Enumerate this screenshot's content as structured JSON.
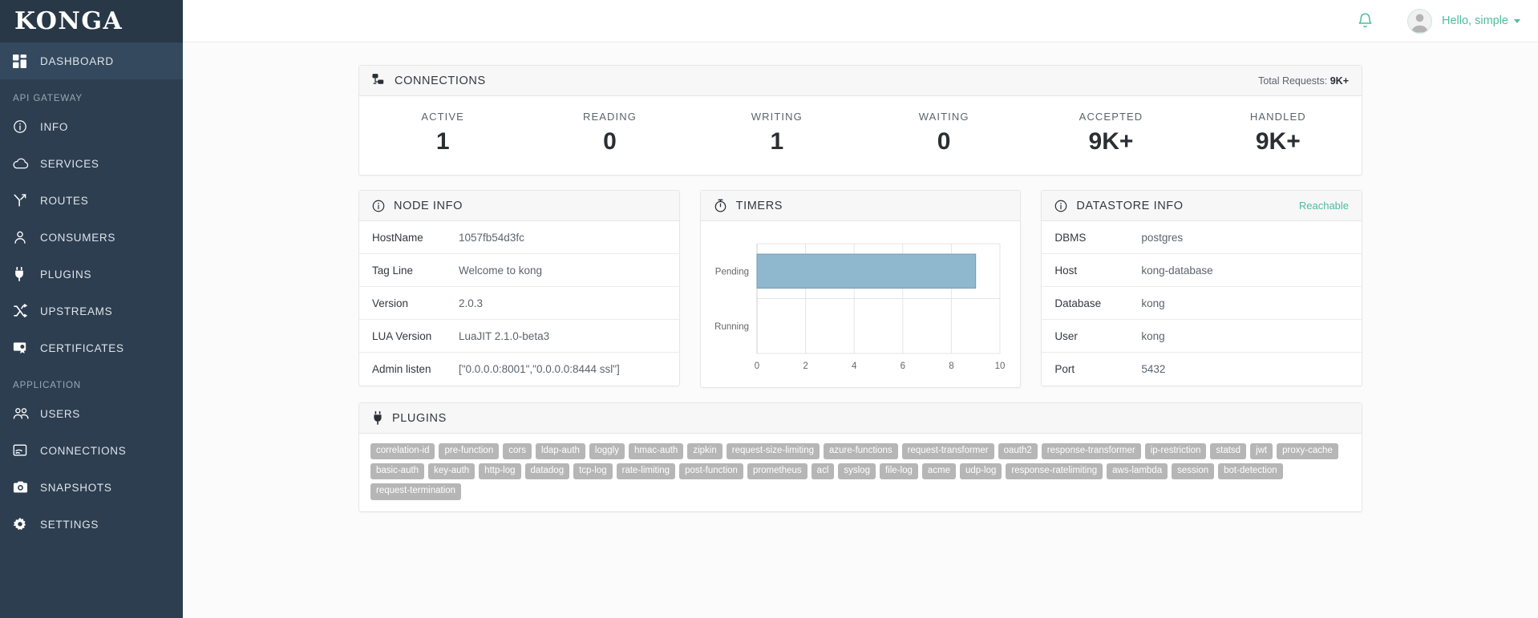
{
  "brand": {
    "name": "KONGA"
  },
  "sidebar": {
    "primary": [
      {
        "label": "DASHBOARD",
        "icon": "dashboard-icon",
        "active": true
      }
    ],
    "sections": [
      {
        "title": "API GATEWAY",
        "items": [
          {
            "label": "INFO",
            "icon": "info-circle-icon"
          },
          {
            "label": "SERVICES",
            "icon": "cloud-icon"
          },
          {
            "label": "ROUTES",
            "icon": "routes-icon"
          },
          {
            "label": "CONSUMERS",
            "icon": "user-icon"
          },
          {
            "label": "PLUGINS",
            "icon": "plug-icon"
          },
          {
            "label": "UPSTREAMS",
            "icon": "shuffle-icon"
          },
          {
            "label": "CERTIFICATES",
            "icon": "certificate-icon"
          }
        ]
      },
      {
        "title": "APPLICATION",
        "items": [
          {
            "label": "USERS",
            "icon": "users-icon"
          },
          {
            "label": "CONNECTIONS",
            "icon": "connection-icon"
          },
          {
            "label": "SNAPSHOTS",
            "icon": "camera-icon"
          },
          {
            "label": "SETTINGS",
            "icon": "gear-icon"
          }
        ]
      }
    ]
  },
  "topbar": {
    "bell_icon": "bell-icon",
    "greeting": "Hello, simple",
    "avatar_icon": "avatar-icon",
    "caret_icon": "chevron-down-icon"
  },
  "connections": {
    "title": "CONNECTIONS",
    "icon": "sitemap-icon",
    "total_requests_label": "Total Requests:",
    "total_requests_value": "9K+",
    "stats": [
      {
        "label": "ACTIVE",
        "value": "1"
      },
      {
        "label": "READING",
        "value": "0"
      },
      {
        "label": "WRITING",
        "value": "1"
      },
      {
        "label": "WAITING",
        "value": "0"
      },
      {
        "label": "ACCEPTED",
        "value": "9K+"
      },
      {
        "label": "HANDLED",
        "value": "9K+"
      }
    ]
  },
  "node_info": {
    "title": "NODE INFO",
    "icon": "info-circle-icon",
    "rows": [
      {
        "key": "HostName",
        "value": "1057fb54d3fc"
      },
      {
        "key": "Tag Line",
        "value": "Welcome to kong"
      },
      {
        "key": "Version",
        "value": "2.0.3"
      },
      {
        "key": "LUA Version",
        "value": "LuaJIT 2.1.0-beta3"
      },
      {
        "key": "Admin listen",
        "value": "[\"0.0.0.0:8001\",\"0.0.0.0:8444 ssl\"]"
      }
    ]
  },
  "timers": {
    "title": "TIMERS",
    "icon": "stopwatch-icon"
  },
  "chart_data": {
    "type": "bar",
    "orientation": "horizontal",
    "title": "TIMERS",
    "categories": [
      "Pending",
      "Running"
    ],
    "values": [
      9,
      0
    ],
    "xlabel": "",
    "ylabel": "",
    "xlim": [
      0,
      10
    ],
    "xticks": [
      "0",
      "2",
      "4",
      "6",
      "8",
      "10"
    ],
    "grid": true,
    "legend": "none",
    "bar_color": "#8fb8ce",
    "bar_border_color": "#6f9db8"
  },
  "datastore_info": {
    "title": "DATASTORE INFO",
    "icon": "info-circle-icon",
    "status": "Reachable",
    "status_color": "#4dbd9f",
    "rows": [
      {
        "key": "DBMS",
        "value": "postgres"
      },
      {
        "key": "Host",
        "value": "kong-database"
      },
      {
        "key": "Database",
        "value": "kong"
      },
      {
        "key": "User",
        "value": "kong"
      },
      {
        "key": "Port",
        "value": "5432"
      }
    ]
  },
  "plugins": {
    "title": "PLUGINS",
    "icon": "plug-icon",
    "tags": [
      "correlation-id",
      "pre-function",
      "cors",
      "ldap-auth",
      "loggly",
      "hmac-auth",
      "zipkin",
      "request-size-limiting",
      "azure-functions",
      "request-transformer",
      "oauth2",
      "response-transformer",
      "ip-restriction",
      "statsd",
      "jwt",
      "proxy-cache",
      "basic-auth",
      "key-auth",
      "http-log",
      "datadog",
      "tcp-log",
      "rate-limiting",
      "post-function",
      "prometheus",
      "acl",
      "syslog",
      "file-log",
      "acme",
      "udp-log",
      "response-ratelimiting",
      "aws-lambda",
      "session",
      "bot-detection",
      "request-termination"
    ]
  },
  "theme": {
    "sidebar_bg": "#2c3e50",
    "sidebar_active_bg": "#34495e",
    "accent_green": "#4dbd9f",
    "page_bg": "#fbfbfb",
    "card_border": "#e6e6e6"
  }
}
